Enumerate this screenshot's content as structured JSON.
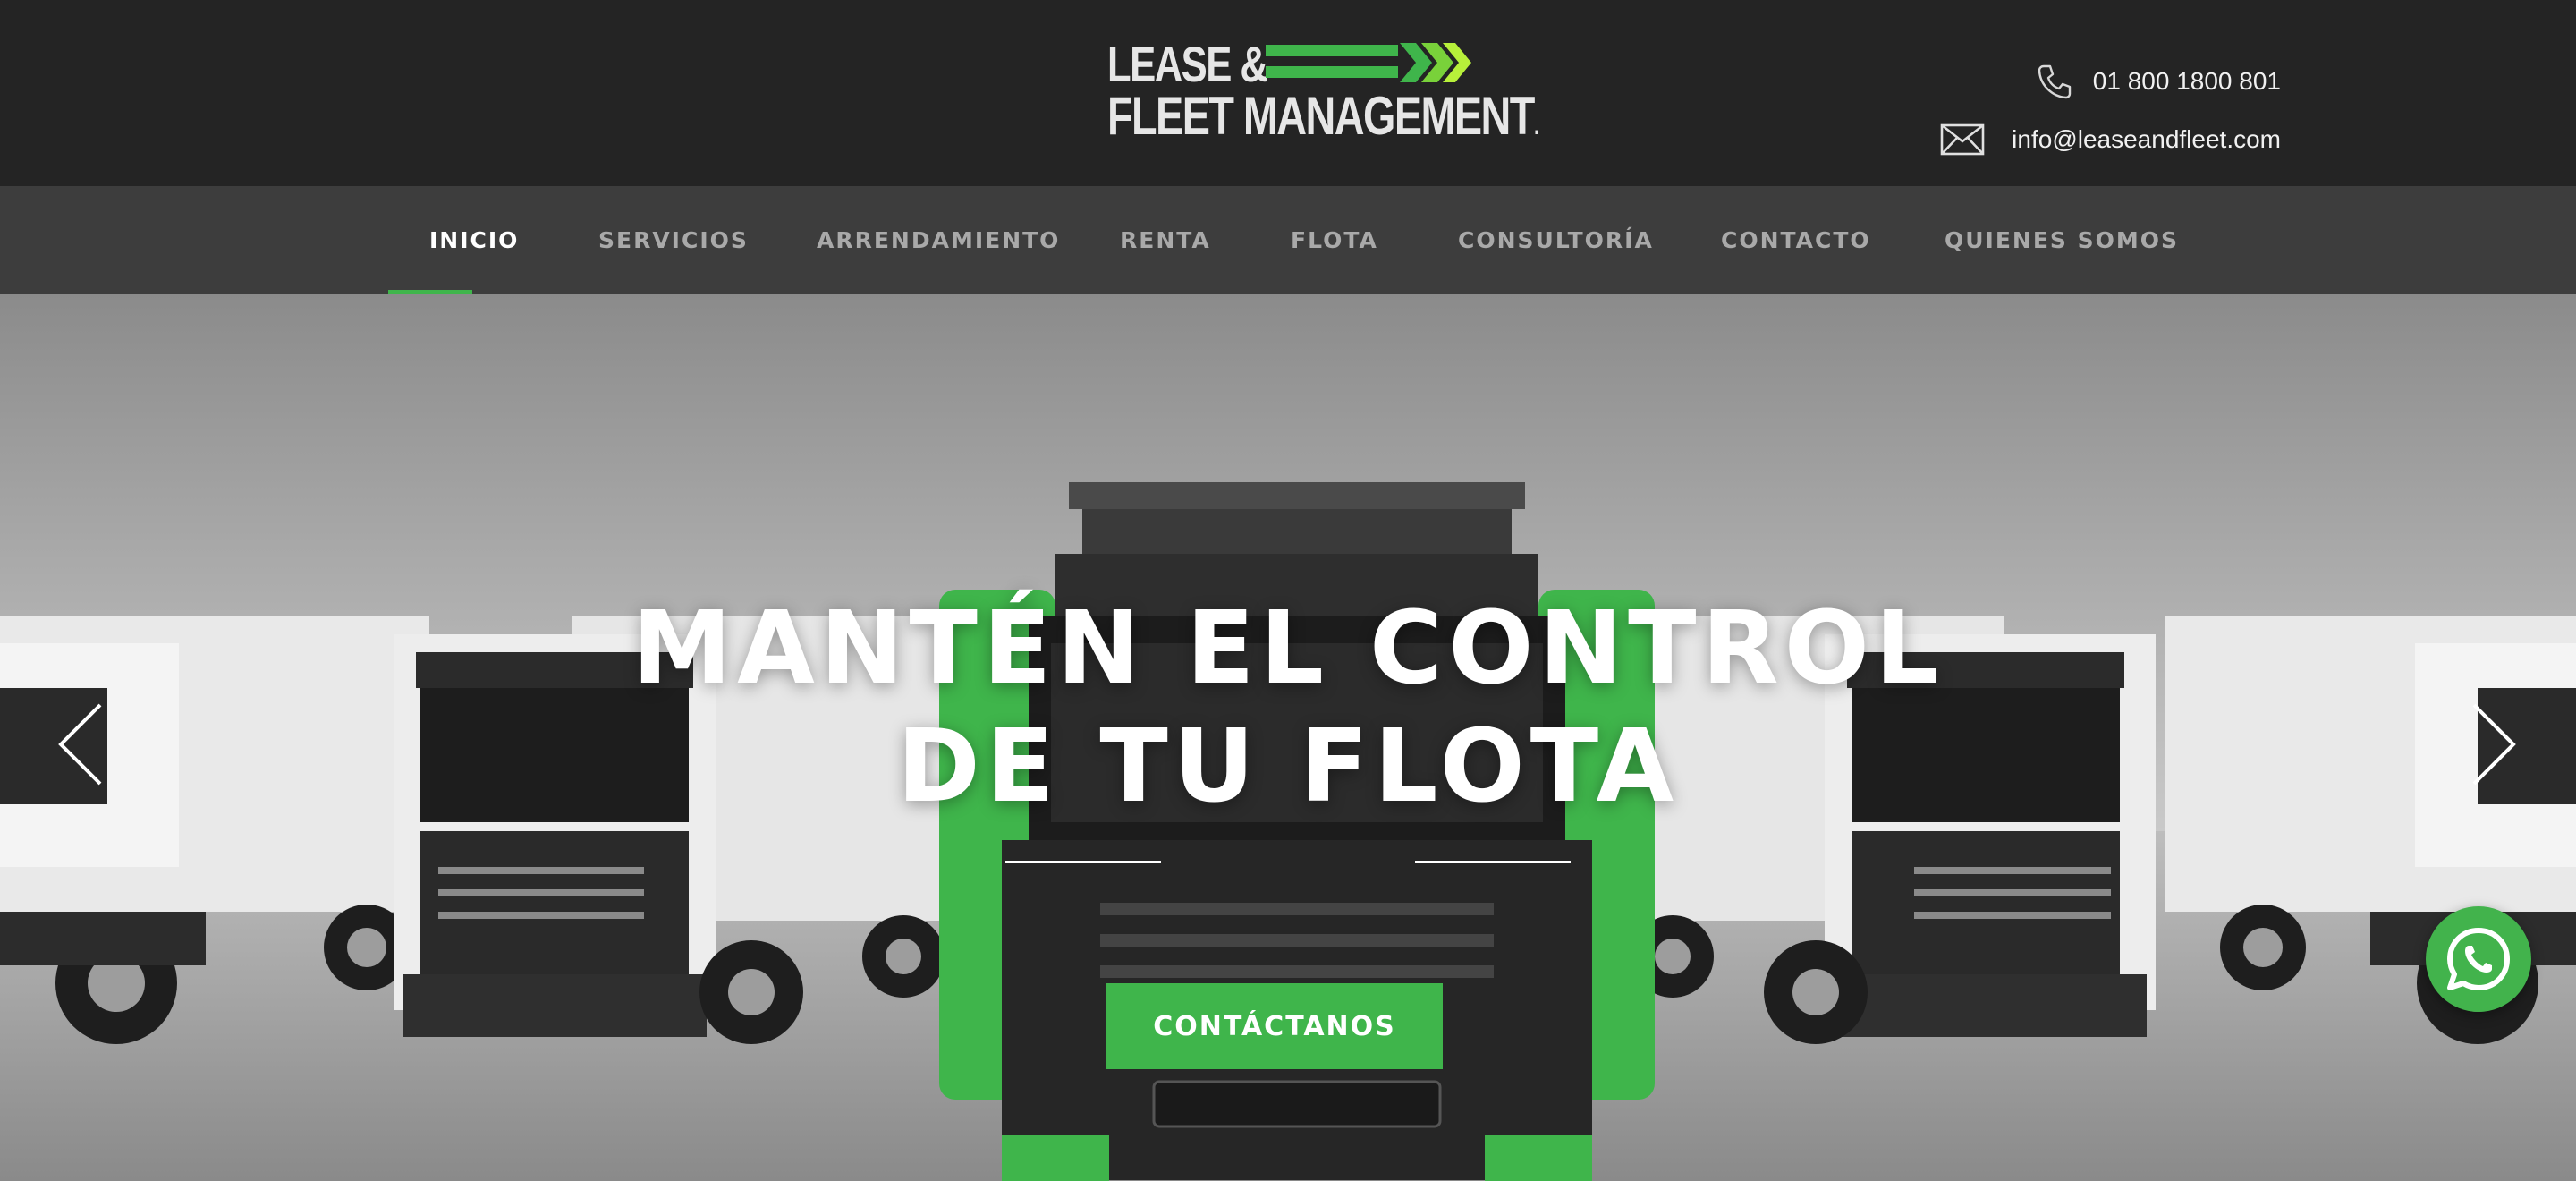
{
  "header": {
    "logo": {
      "line1": "LEASE &",
      "line2": "FLEET MANAGEMENT",
      "mark": "."
    },
    "phone": "01 800 1800 801",
    "email": "info@leaseandfleet.com",
    "icons": {
      "phone": "phone-icon",
      "email": "envelope-icon"
    }
  },
  "nav": {
    "items": [
      {
        "label": "INICIO",
        "active": true
      },
      {
        "label": "SERVICIOS"
      },
      {
        "label": "ARRENDAMIENTO"
      },
      {
        "label": "RENTA"
      },
      {
        "label": "FLOTA"
      },
      {
        "label": "CONSULTORÍA"
      },
      {
        "label": "CONTACTO"
      },
      {
        "label": "QUIENES SOMOS"
      }
    ]
  },
  "hero": {
    "title_line1": "MANTÉN EL CONTROL",
    "title_line2": "DE TU FLOTA",
    "cta_label": "CONTÁCTANOS",
    "icons": {
      "prev": "chevron-left-icon",
      "next": "chevron-right-icon",
      "chat": "whatsapp-icon"
    }
  },
  "colors": {
    "header_bg": "#242424",
    "nav_bg": "#3d3d3d",
    "accent_green": "#3fb54b",
    "lime": "#b7f03a",
    "nav_text": "#a9a9a9",
    "white": "#ffffff"
  }
}
